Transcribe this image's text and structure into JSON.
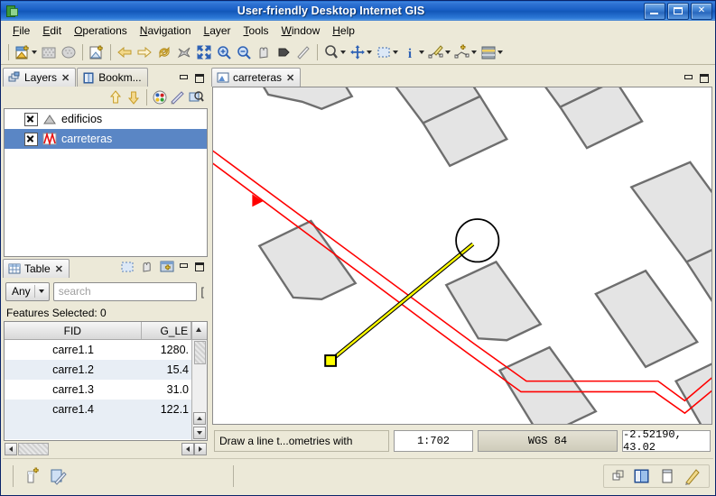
{
  "window": {
    "title": "User-friendly Desktop Internet GIS",
    "icon": "gis-app-icon",
    "minimize_label": "_",
    "maximize_label": "□",
    "close_label": "✕"
  },
  "menubar": {
    "items": [
      {
        "label": "File",
        "mnemonic": "F"
      },
      {
        "label": "Edit",
        "mnemonic": "E"
      },
      {
        "label": "Operations",
        "mnemonic": "O"
      },
      {
        "label": "Navigation",
        "mnemonic": "N"
      },
      {
        "label": "Layer",
        "mnemonic": "L"
      },
      {
        "label": "Tools",
        "mnemonic": "T"
      },
      {
        "label": "Window",
        "mnemonic": "W"
      },
      {
        "label": "Help",
        "mnemonic": "H"
      }
    ]
  },
  "toolbar": {
    "groups": [
      {
        "items": [
          {
            "name": "new-project-icon",
            "dropdown": true
          },
          {
            "name": "add-layer-icon",
            "dropdown": false
          },
          {
            "name": "remove-layer-icon",
            "dropdown": false
          }
        ]
      },
      {
        "items": [
          {
            "name": "new-view-icon",
            "dropdown": false
          }
        ]
      },
      {
        "items": [
          {
            "name": "back-arrow-icon",
            "dropdown": false
          },
          {
            "name": "forward-arrow-icon",
            "dropdown": false
          },
          {
            "name": "refresh-icon",
            "dropdown": false
          },
          {
            "name": "zoom-all-icon",
            "dropdown": false
          },
          {
            "name": "full-extent-icon",
            "dropdown": false
          },
          {
            "name": "zoom-in-icon",
            "dropdown": false
          },
          {
            "name": "zoom-out-icon",
            "dropdown": false
          },
          {
            "name": "pan-icon",
            "dropdown": false
          },
          {
            "name": "zoom-to-selection-icon",
            "dropdown": false
          },
          {
            "name": "measure-icon",
            "dropdown": false
          }
        ]
      },
      {
        "items": [
          {
            "name": "zoom-tool-icon",
            "dropdown": true
          },
          {
            "name": "pan-tool-icon",
            "dropdown": true
          },
          {
            "name": "select-rect-icon",
            "dropdown": true
          },
          {
            "name": "info-tool-icon",
            "dropdown": true
          },
          {
            "name": "edit-geometry-icon",
            "dropdown": true
          },
          {
            "name": "insert-vertex-icon",
            "dropdown": true
          },
          {
            "name": "layer-properties-icon",
            "dropdown": true
          }
        ]
      }
    ]
  },
  "layers_panel": {
    "tabs": [
      {
        "label": "Layers",
        "icon": "layers-icon",
        "active": true,
        "closable": true
      },
      {
        "label": "Bookm...",
        "icon": "bookmark-icon",
        "active": false,
        "closable": false
      }
    ],
    "tools": [
      {
        "name": "move-up-icon"
      },
      {
        "name": "move-down-icon"
      },
      {
        "name": "symbology-palette-icon"
      },
      {
        "name": "layer-style-icon"
      },
      {
        "name": "zoom-to-layer-icon"
      }
    ],
    "window_buttons": [
      "minimize",
      "maximize"
    ],
    "layers": [
      {
        "name": "edificios",
        "checked": true,
        "selected": false,
        "icon": "polygon-layer-icon"
      },
      {
        "name": "carreteras",
        "checked": true,
        "selected": true,
        "icon": "line-layer-icon"
      }
    ]
  },
  "table_panel": {
    "tabs": [
      {
        "label": "Table",
        "icon": "table-icon",
        "active": true,
        "closable": true
      }
    ],
    "tools": [
      {
        "name": "select-all-icon"
      },
      {
        "name": "clear-selection-icon"
      },
      {
        "name": "add-record-icon"
      }
    ],
    "window_buttons": [
      "minimize",
      "maximize"
    ],
    "filter": {
      "combo_value": "Any",
      "search_placeholder": "search",
      "bracket": "["
    },
    "features_selected": "Features Selected: 0",
    "columns": [
      "FID",
      "G_LE"
    ],
    "rows": [
      {
        "fid": "carre1.1",
        "g_le": "1280."
      },
      {
        "fid": "carre1.2",
        "g_le": "15.4"
      },
      {
        "fid": "carre1.3",
        "g_le": "31.0"
      },
      {
        "fid": "carre1.4",
        "g_le": "122.1"
      }
    ]
  },
  "map_view": {
    "tabs": [
      {
        "label": "carreteras",
        "icon": "map-view-icon",
        "active": true,
        "closable": true
      }
    ],
    "window_buttons": [
      "minimize",
      "maximize"
    ],
    "canvas": {
      "background_color": "#ffffff",
      "building_fill": "#e4e4e4",
      "building_stroke": "#6e6e6e",
      "road_color": "#ff0000",
      "draw_line_color": "#ffff00",
      "draw_line_outline": "#000000",
      "vertex_handle_color": "#ffff00",
      "cursor_shape": "circle"
    }
  },
  "statusbar": {
    "message": "Draw a line t...ometries with",
    "scale": "1:702",
    "projection": "WGS 84",
    "coordinates": "-2.52190, 43.02"
  },
  "bottombar": {
    "left_icons": [
      {
        "name": "new-feature-icon"
      },
      {
        "name": "edit-session-icon"
      }
    ],
    "right_icons": [
      {
        "name": "window-layout-icon"
      },
      {
        "name": "perspective-switch-icon"
      },
      {
        "name": "panel-view-icon"
      },
      {
        "name": "drawing-tools-icon"
      }
    ]
  }
}
